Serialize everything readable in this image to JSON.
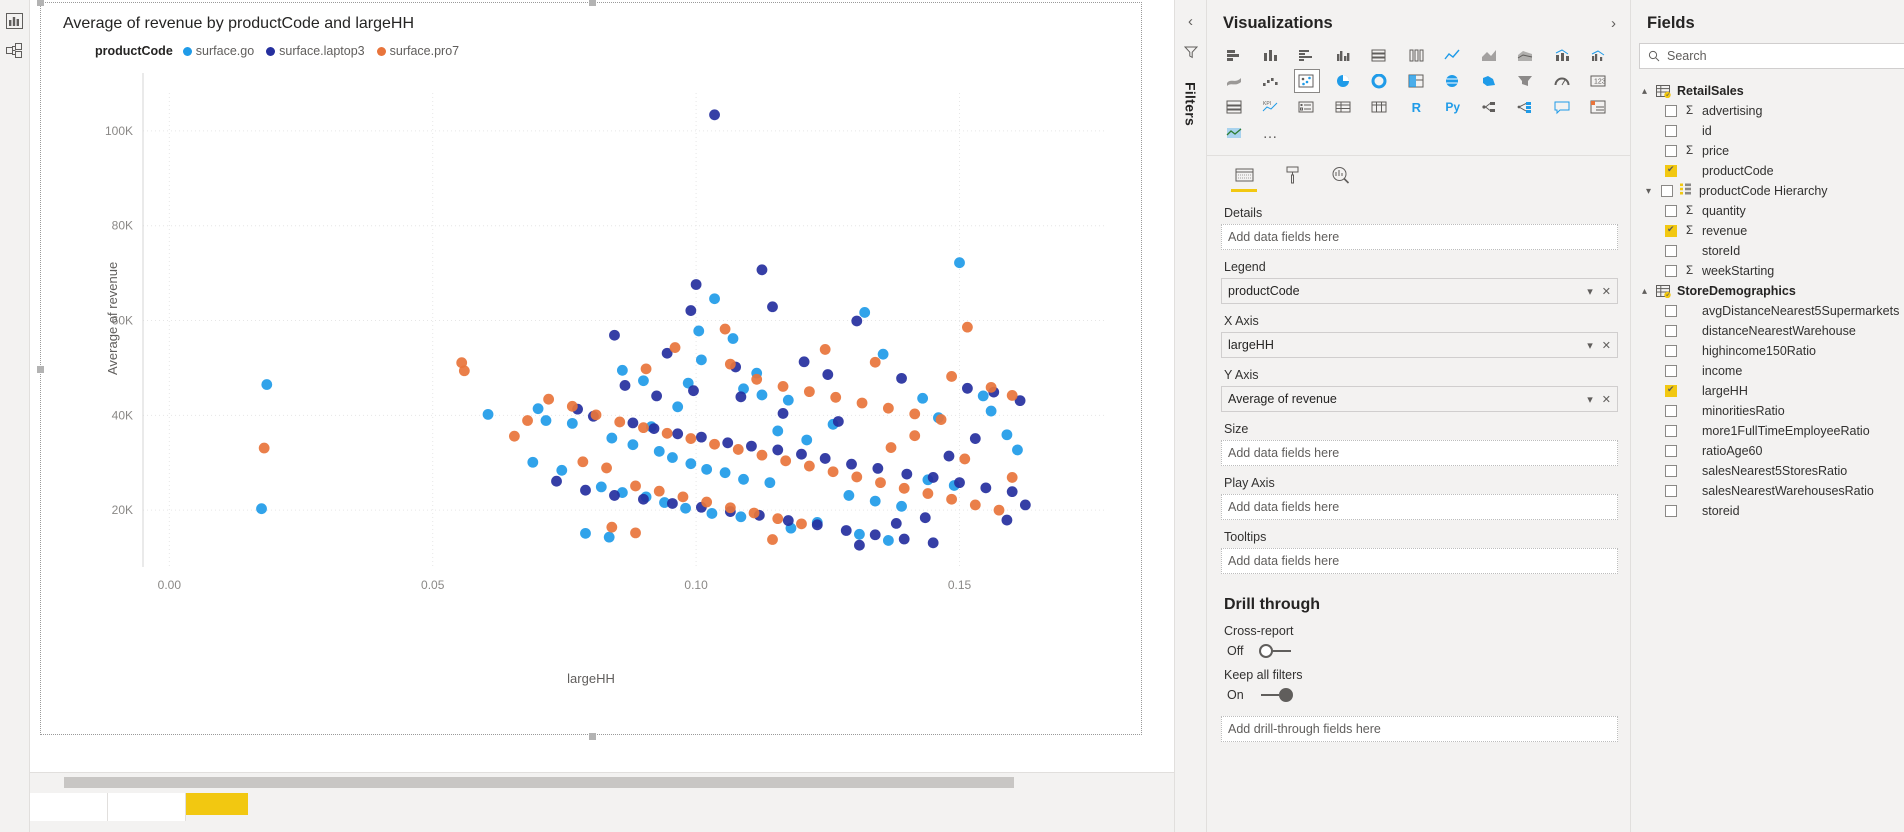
{
  "left_rail": {
    "items": [
      {
        "name": "report-view-icon",
        "label": "Report"
      },
      {
        "name": "model-view-icon",
        "label": "Model"
      }
    ]
  },
  "canvas": {
    "visual": {
      "title": "Average of revenue by productCode and largeHH",
      "legend": {
        "title": "productCode",
        "items": [
          {
            "label": "surface.go",
            "color": "#1F9BE8"
          },
          {
            "label": "surface.laptop3",
            "color": "#252F9E"
          },
          {
            "label": "surface.pro7",
            "color": "#E8743B"
          }
        ]
      },
      "x_axis_title": "largeHH",
      "y_axis_title": "Average of revenue"
    }
  },
  "chart_data": {
    "type": "scatter",
    "title": "Average of revenue by productCode and largeHH",
    "xlabel": "largeHH",
    "ylabel": "Average of revenue",
    "xlim": [
      -0.005,
      0.178
    ],
    "ylim": [
      8000,
      108000
    ],
    "xticks": [
      0.0,
      0.05,
      0.1,
      0.15
    ],
    "xticklabels": [
      "0.00",
      "0.05",
      "0.10",
      "0.15"
    ],
    "yticks": [
      20000,
      40000,
      60000,
      80000,
      100000
    ],
    "yticklabels": [
      "20K",
      "40K",
      "60K",
      "80K",
      "100K"
    ],
    "grid": true,
    "legend_position": "top-left",
    "series": [
      {
        "name": "surface.go",
        "color": "#1F9BE8",
        "points": [
          [
            0.0185,
            46500
          ],
          [
            0.0175,
            20300
          ],
          [
            0.0605,
            40200
          ],
          [
            0.07,
            41400
          ],
          [
            0.0715,
            38900
          ],
          [
            0.0765,
            38300
          ],
          [
            0.086,
            49500
          ],
          [
            0.09,
            47300
          ],
          [
            0.1035,
            64600
          ],
          [
            0.1005,
            57800
          ],
          [
            0.107,
            56200
          ],
          [
            0.101,
            51700
          ],
          [
            0.0985,
            46800
          ],
          [
            0.109,
            45600
          ],
          [
            0.1125,
            44300
          ],
          [
            0.1175,
            43200
          ],
          [
            0.132,
            61700
          ],
          [
            0.1355,
            52900
          ],
          [
            0.143,
            43600
          ],
          [
            0.15,
            72200
          ],
          [
            0.1545,
            44100
          ],
          [
            0.156,
            40900
          ],
          [
            0.146,
            39500
          ],
          [
            0.126,
            38100
          ],
          [
            0.084,
            35200
          ],
          [
            0.088,
            33800
          ],
          [
            0.093,
            32400
          ],
          [
            0.0955,
            31100
          ],
          [
            0.099,
            29800
          ],
          [
            0.102,
            28600
          ],
          [
            0.1055,
            27900
          ],
          [
            0.109,
            26500
          ],
          [
            0.114,
            25800
          ],
          [
            0.082,
            24900
          ],
          [
            0.086,
            23700
          ],
          [
            0.0905,
            22800
          ],
          [
            0.094,
            21600
          ],
          [
            0.098,
            20400
          ],
          [
            0.103,
            19300
          ],
          [
            0.1085,
            18600
          ],
          [
            0.129,
            23100
          ],
          [
            0.134,
            21900
          ],
          [
            0.139,
            20800
          ],
          [
            0.144,
            26400
          ],
          [
            0.149,
            25200
          ],
          [
            0.123,
            17400
          ],
          [
            0.118,
            16200
          ],
          [
            0.079,
            15100
          ],
          [
            0.0835,
            14300
          ],
          [
            0.131,
            14900
          ],
          [
            0.1365,
            13600
          ],
          [
            0.159,
            35900
          ],
          [
            0.161,
            32700
          ],
          [
            0.0745,
            28400
          ],
          [
            0.069,
            30100
          ],
          [
            0.1155,
            36700
          ],
          [
            0.121,
            34800
          ],
          [
            0.0915,
            37600
          ],
          [
            0.0965,
            41800
          ],
          [
            0.1115,
            48900
          ]
        ]
      },
      {
        "name": "surface.laptop3",
        "color": "#252F9E",
        "points": [
          [
            0.1035,
            103400
          ],
          [
            0.1125,
            70700
          ],
          [
            0.1,
            67600
          ],
          [
            0.099,
            62100
          ],
          [
            0.1145,
            62900
          ],
          [
            0.1305,
            59900
          ],
          [
            0.0845,
            56900
          ],
          [
            0.1205,
            51300
          ],
          [
            0.0945,
            53100
          ],
          [
            0.1075,
            50200
          ],
          [
            0.125,
            48600
          ],
          [
            0.139,
            47800
          ],
          [
            0.1515,
            45700
          ],
          [
            0.1565,
            44900
          ],
          [
            0.1615,
            43100
          ],
          [
            0.0775,
            41300
          ],
          [
            0.0805,
            39800
          ],
          [
            0.088,
            38400
          ],
          [
            0.092,
            37200
          ],
          [
            0.0965,
            36100
          ],
          [
            0.101,
            35400
          ],
          [
            0.106,
            34200
          ],
          [
            0.1105,
            33500
          ],
          [
            0.1155,
            32700
          ],
          [
            0.12,
            31800
          ],
          [
            0.1245,
            30900
          ],
          [
            0.1295,
            29700
          ],
          [
            0.1345,
            28800
          ],
          [
            0.14,
            27600
          ],
          [
            0.145,
            26900
          ],
          [
            0.15,
            25800
          ],
          [
            0.155,
            24700
          ],
          [
            0.16,
            23900
          ],
          [
            0.0735,
            26100
          ],
          [
            0.079,
            24200
          ],
          [
            0.0845,
            23100
          ],
          [
            0.09,
            22300
          ],
          [
            0.0955,
            21400
          ],
          [
            0.101,
            20600
          ],
          [
            0.1065,
            19700
          ],
          [
            0.112,
            18900
          ],
          [
            0.1175,
            17800
          ],
          [
            0.123,
            16900
          ],
          [
            0.1285,
            15700
          ],
          [
            0.134,
            14800
          ],
          [
            0.1395,
            13900
          ],
          [
            0.145,
            13100
          ],
          [
            0.138,
            17200
          ],
          [
            0.159,
            17900
          ],
          [
            0.1625,
            21100
          ],
          [
            0.1165,
            40400
          ],
          [
            0.1085,
            43900
          ],
          [
            0.0995,
            45200
          ],
          [
            0.148,
            31400
          ],
          [
            0.153,
            35100
          ],
          [
            0.127,
            38700
          ],
          [
            0.0865,
            46300
          ],
          [
            0.0925,
            44100
          ],
          [
            0.1435,
            18400
          ],
          [
            0.131,
            12600
          ]
        ]
      },
      {
        "name": "surface.pro7",
        "color": "#E8743B",
        "points": [
          [
            0.018,
            33100
          ],
          [
            0.0555,
            51100
          ],
          [
            0.056,
            49400
          ],
          [
            0.134,
            51200
          ],
          [
            0.096,
            54300
          ],
          [
            0.1065,
            50800
          ],
          [
            0.1115,
            47600
          ],
          [
            0.1165,
            46100
          ],
          [
            0.1215,
            45000
          ],
          [
            0.1265,
            43800
          ],
          [
            0.1315,
            42600
          ],
          [
            0.1365,
            41500
          ],
          [
            0.1415,
            40300
          ],
          [
            0.1465,
            39100
          ],
          [
            0.072,
            43400
          ],
          [
            0.0765,
            41900
          ],
          [
            0.081,
            40100
          ],
          [
            0.0855,
            38600
          ],
          [
            0.09,
            37400
          ],
          [
            0.0945,
            36200
          ],
          [
            0.099,
            35100
          ],
          [
            0.1035,
            33900
          ],
          [
            0.108,
            32800
          ],
          [
            0.1125,
            31600
          ],
          [
            0.117,
            30400
          ],
          [
            0.1215,
            29300
          ],
          [
            0.126,
            28100
          ],
          [
            0.1305,
            27000
          ],
          [
            0.135,
            25800
          ],
          [
            0.1395,
            24600
          ],
          [
            0.144,
            23500
          ],
          [
            0.1485,
            22300
          ],
          [
            0.153,
            21100
          ],
          [
            0.1575,
            20000
          ],
          [
            0.068,
            38900
          ],
          [
            0.0655,
            35600
          ],
          [
            0.0885,
            25100
          ],
          [
            0.093,
            24000
          ],
          [
            0.0975,
            22800
          ],
          [
            0.102,
            21700
          ],
          [
            0.1065,
            20500
          ],
          [
            0.111,
            19400
          ],
          [
            0.1155,
            18200
          ],
          [
            0.12,
            17100
          ],
          [
            0.084,
            16400
          ],
          [
            0.0885,
            15200
          ],
          [
            0.156,
            45900
          ],
          [
            0.16,
            44200
          ],
          [
            0.1485,
            48200
          ],
          [
            0.1245,
            53900
          ],
          [
            0.0785,
            30200
          ],
          [
            0.083,
            28900
          ],
          [
            0.1415,
            35700
          ],
          [
            0.137,
            33200
          ],
          [
            0.151,
            30800
          ],
          [
            0.16,
            26900
          ],
          [
            0.1055,
            58200
          ],
          [
            0.1515,
            58600
          ],
          [
            0.0905,
            49800
          ],
          [
            0.1145,
            13800
          ]
        ]
      }
    ]
  },
  "filters_strip": {
    "label": "Filters",
    "collapse_icon": "chevron-left-icon",
    "funnel_icon": "funnel-icon"
  },
  "visualizations": {
    "title": "Visualizations",
    "collapse_chevron": "›",
    "icons_row1": [
      "stacked-bar-chart-icon",
      "stacked-column-chart-icon",
      "clustered-bar-chart-icon",
      "clustered-column-chart-icon",
      "hundred-stacked-bar-icon",
      "hundred-stacked-column-icon",
      "line-chart-icon",
      "area-chart-icon",
      "stacked-area-chart-icon",
      "line-stacked-column-icon",
      "line-clustered-column-icon",
      "ribbon-chart-icon",
      "waterfall-chart-icon"
    ],
    "icons_row2": [
      "scatter-chart-icon",
      "pie-chart-icon",
      "donut-chart-icon",
      "treemap-icon",
      "map-icon",
      "filled-map-icon",
      "funnel-chart-icon",
      "gauge-icon",
      "card-icon",
      "multi-row-card-icon",
      "kpi-icon",
      "slicer-icon",
      "table-icon",
      "matrix-icon",
      "r-script-visual-icon"
    ],
    "icons_row3": [
      "python-visual-icon",
      "decomposition-tree-icon",
      "key-influencers-icon",
      "qna-icon",
      "paginated-report-icon",
      "arcgis-map-icon"
    ],
    "more_label": "…",
    "tabs": [
      {
        "name": "fields-tab",
        "icon": "fields-icon",
        "active": true
      },
      {
        "name": "format-tab",
        "icon": "paint-roller-icon",
        "active": false
      },
      {
        "name": "analytics-tab",
        "icon": "magnifier-chart-icon",
        "active": false
      }
    ],
    "wells": [
      {
        "label": "Details",
        "value": "",
        "placeholder": "Add data fields here",
        "filled": false
      },
      {
        "label": "Legend",
        "value": "productCode",
        "placeholder": "Add data fields here",
        "filled": true
      },
      {
        "label": "X Axis",
        "value": "largeHH",
        "placeholder": "Add data fields here",
        "filled": true
      },
      {
        "label": "Y Axis",
        "value": "Average of revenue",
        "placeholder": "Add data fields here",
        "filled": true
      },
      {
        "label": "Size",
        "value": "",
        "placeholder": "Add data fields here",
        "filled": false
      },
      {
        "label": "Play Axis",
        "value": "",
        "placeholder": "Add data fields here",
        "filled": false
      },
      {
        "label": "Tooltips",
        "value": "",
        "placeholder": "Add data fields here",
        "filled": false
      }
    ],
    "drill_through": {
      "title": "Drill through",
      "cross_report": {
        "label": "Cross-report",
        "state": "Off",
        "on": false
      },
      "keep_all_filters": {
        "label": "Keep all filters",
        "state": "On",
        "on": true
      },
      "field_placeholder": "Add drill-through fields here"
    }
  },
  "fields": {
    "title": "Fields",
    "collapse_chevron": "›",
    "search_placeholder": "Search",
    "search_icon": "search-icon",
    "tables": [
      {
        "name": "RetailSales",
        "expanded": true,
        "fields": [
          {
            "name": "advertising",
            "checked": false,
            "numeric": true,
            "hierarchy": false
          },
          {
            "name": "id",
            "checked": false,
            "numeric": false,
            "hierarchy": false
          },
          {
            "name": "price",
            "checked": false,
            "numeric": true,
            "hierarchy": false
          },
          {
            "name": "productCode",
            "checked": true,
            "numeric": false,
            "hierarchy": false
          },
          {
            "name": "productCode Hierarchy",
            "checked": false,
            "numeric": false,
            "hierarchy": true
          },
          {
            "name": "quantity",
            "checked": false,
            "numeric": true,
            "hierarchy": false
          },
          {
            "name": "revenue",
            "checked": true,
            "numeric": true,
            "hierarchy": false
          },
          {
            "name": "storeId",
            "checked": false,
            "numeric": false,
            "hierarchy": false
          },
          {
            "name": "weekStarting",
            "checked": false,
            "numeric": true,
            "hierarchy": false
          }
        ]
      },
      {
        "name": "StoreDemographics",
        "expanded": true,
        "fields": [
          {
            "name": "avgDistanceNearest5Supermarkets",
            "checked": false,
            "numeric": false,
            "hierarchy": false
          },
          {
            "name": "distanceNearestWarehouse",
            "checked": false,
            "numeric": false,
            "hierarchy": false
          },
          {
            "name": "highincome150Ratio",
            "checked": false,
            "numeric": false,
            "hierarchy": false
          },
          {
            "name": "income",
            "checked": false,
            "numeric": false,
            "hierarchy": false
          },
          {
            "name": "largeHH",
            "checked": true,
            "numeric": false,
            "hierarchy": false
          },
          {
            "name": "minoritiesRatio",
            "checked": false,
            "numeric": false,
            "hierarchy": false
          },
          {
            "name": "more1FullTimeEmployeeRatio",
            "checked": false,
            "numeric": false,
            "hierarchy": false
          },
          {
            "name": "ratioAge60",
            "checked": false,
            "numeric": false,
            "hierarchy": false
          },
          {
            "name": "salesNearest5StoresRatio",
            "checked": false,
            "numeric": false,
            "hierarchy": false
          },
          {
            "name": "salesNearestWarehousesRatio",
            "checked": false,
            "numeric": false,
            "hierarchy": false
          },
          {
            "name": "storeid",
            "checked": false,
            "numeric": false,
            "hierarchy": false
          }
        ]
      }
    ]
  },
  "colors": {
    "accent_yellow": "#f2c811",
    "pane_bg": "#f3f2f1",
    "text": "#252423"
  }
}
